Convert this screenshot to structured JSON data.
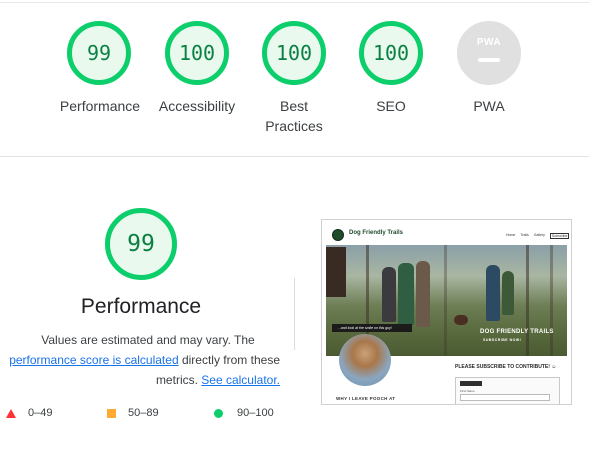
{
  "categories": [
    {
      "score": "99",
      "label": "Performance"
    },
    {
      "score": "100",
      "label": "Accessibility"
    },
    {
      "score": "100",
      "label_line1": "Best",
      "label_line2": "Practices"
    },
    {
      "score": "100",
      "label": "SEO"
    },
    {
      "badge": "PWA",
      "label": "PWA"
    }
  ],
  "colors": {
    "pass": "#0cce6b",
    "pass_text": "#0b8043",
    "average": "#ffaa33",
    "fail": "#ff3333",
    "link": "#1a73e8"
  },
  "detail": {
    "score": "99",
    "title": "Performance",
    "desc_line1": "Values are estimated and may vary. The",
    "link1": "performance score is calculated",
    "desc_mid": " directly from these",
    "desc_line3": "metrics. ",
    "link2": "See calculator."
  },
  "legend": [
    {
      "icon": "triangle-icon",
      "range": "0–49"
    },
    {
      "icon": "square-icon",
      "range": "50–89"
    },
    {
      "icon": "circle-icon",
      "range": "90–100"
    }
  ],
  "screenshot": {
    "site_name": "Dog Friendly Trails",
    "nav": [
      "Home",
      "Trails",
      "Gallery",
      "Subscribe"
    ],
    "hero_title": "DOG FRIENDLY TRAILS",
    "hero_sub": "SUBSCRIBE NOW!",
    "caption": "...and look at the smile on this guy!",
    "subscribe_text": "PLEASE SUBSCRIBE TO CONTRIBUTE! ☺",
    "why_text": "WHY I LEAVE POOCH AT",
    "form_label": "First Name"
  }
}
